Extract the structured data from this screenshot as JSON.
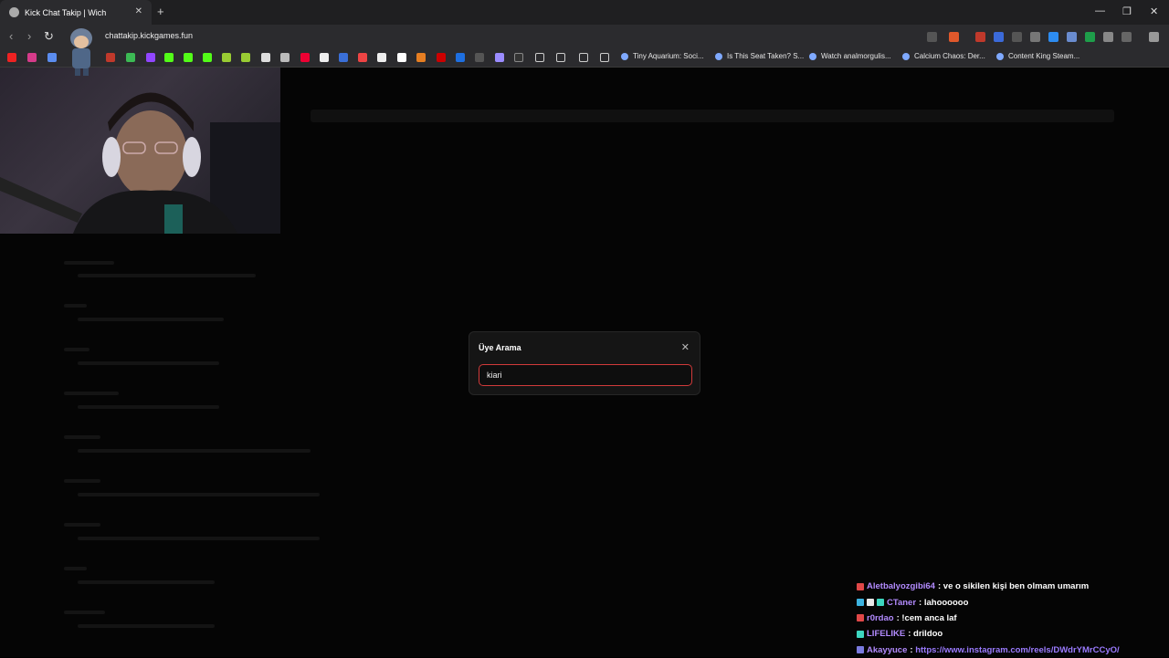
{
  "browser": {
    "tab_title": "Kick Chat Takip | Wich",
    "tab_close": "✕",
    "new_tab": "+",
    "url": "chattakip.kickgames.fun",
    "window_controls": [
      "—",
      "❐",
      "✕"
    ],
    "nav": {
      "back": "‹",
      "forward": "›",
      "reload": "↻"
    },
    "bookmarks": [
      "Tiny Aquarium: Soci...",
      "Is This Seat Taken? S...",
      "Watch analmorgulis...",
      "Calcium Chaos: Der...",
      "Content King Steam..."
    ]
  },
  "modal": {
    "title": "Üye Arama",
    "close": "✕",
    "input_value": "kiari"
  },
  "chat": [
    {
      "user": "Aletbalyozgibi64",
      "sep": ":",
      "message": "ve o sikilen kişi ben olmam umarım",
      "user_color": "#b38bff",
      "badges": [
        "#e04848"
      ]
    },
    {
      "user": "CTaner",
      "sep": ":",
      "message": "lahoooooo",
      "user_color": "#b38bff",
      "badges": [
        "#3db3e0",
        "#e8e8e8",
        "#3dd6c0"
      ]
    },
    {
      "user": "r0rdao",
      "sep": ":",
      "message": "!cem anca laf",
      "user_color": "#b38bff",
      "badges": [
        "#e04848"
      ]
    },
    {
      "user": "LIFELIKE",
      "sep": ":",
      "message": "drildoo",
      "user_color": "#b38bff",
      "badges": [
        "#3dd6c0"
      ]
    },
    {
      "user": "Akayyuce",
      "sep": ":",
      "message": "https://www.instagram.com/reels/DWdrYMrCCyO/",
      "user_color": "#b38bff",
      "badges": [
        "#7a7adf"
      ],
      "is_link": true
    }
  ]
}
